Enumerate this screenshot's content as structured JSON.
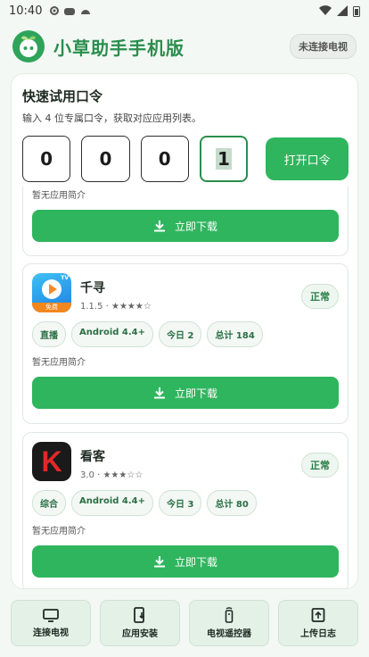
{
  "status_bar": {
    "time": "10:40"
  },
  "header": {
    "title": "小草助手手机版",
    "connection_status": "未连接电视"
  },
  "quick_code": {
    "heading": "快速试用口令",
    "hint": "输入 4 位专属口令，获取对应应用列表。",
    "digits": [
      "0",
      "0",
      "0",
      "1"
    ],
    "open_label": "打开口令"
  },
  "apps": [
    {
      "desc": "暂无应用简介",
      "download_label": "立即下载"
    },
    {
      "name": "千寻",
      "version": "1.1.5",
      "rating_stars": "★★★★☆",
      "status": "正常",
      "tags": [
        "直播",
        "Android 4.4+",
        "今日 2",
        "总计 184"
      ],
      "desc": "暂无应用简介",
      "download_label": "立即下载",
      "icon_badge": "免费",
      "icon_badge_top": "TV"
    },
    {
      "name": "看客",
      "version": "3.0",
      "rating_stars": "★★★☆☆",
      "status": "正常",
      "tags": [
        "综合",
        "Android 4.4+",
        "今日 3",
        "总计 80"
      ],
      "desc": "暂无应用简介",
      "download_label": "立即下载",
      "icon_letter": "K"
    }
  ],
  "bottom_nav": [
    {
      "label": "连接电视",
      "icon": "tv-icon"
    },
    {
      "label": "应用安装",
      "icon": "install-icon"
    },
    {
      "label": "电视遥控器",
      "icon": "remote-icon"
    },
    {
      "label": "上传日志",
      "icon": "upload-icon"
    }
  ],
  "colors": {
    "accent": "#2fb55e",
    "title_green": "#2a8e4d"
  }
}
